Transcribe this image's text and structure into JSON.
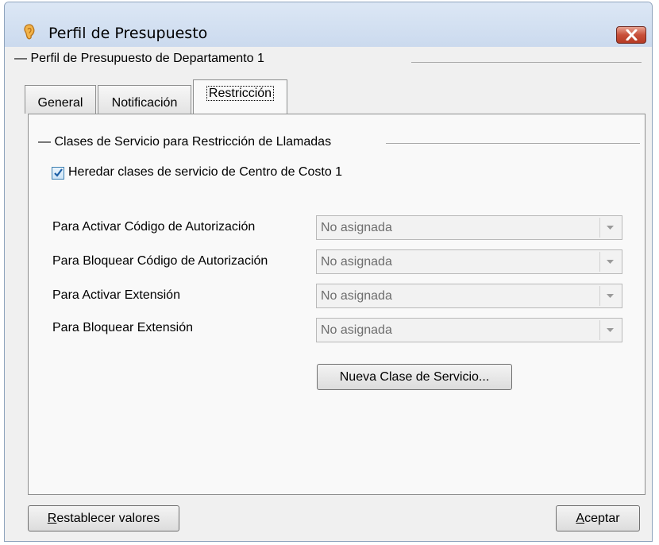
{
  "window": {
    "title": "Perfil de Presupuesto",
    "app_icon": "ear-icon",
    "close_icon": "close-icon"
  },
  "group_profile": {
    "label": "Perfil de Presupuesto de Departamento 1"
  },
  "tabs": [
    {
      "label": "General",
      "active": false
    },
    {
      "label": "Notificación",
      "active": false
    },
    {
      "label": "Restricción",
      "active": true
    }
  ],
  "restriction": {
    "group_label": "Clases de Servicio para Restricción de Llamadas",
    "inherit_checkbox": {
      "label": "Heredar clases de servicio de Centro de Costo 1",
      "checked": true
    },
    "rows": [
      {
        "label": "Para Activar Código de Autorización",
        "value": "No asignada"
      },
      {
        "label": "Para Bloquear Código de Autorización",
        "value": "No asignada"
      },
      {
        "label": "Para Activar Extensión",
        "value": "No asignada"
      },
      {
        "label": "Para Bloquear Extensión",
        "value": "No asignada"
      }
    ],
    "new_class_button": "Nueva Clase de Servicio..."
  },
  "footer": {
    "reset_button": {
      "mnemonic": "R",
      "rest": "establecer valores"
    },
    "accept_button": {
      "mnemonic": "A",
      "rest": "ceptar"
    }
  },
  "colors": {
    "close_button": "#c8503a",
    "titlebar": "#cbdaee",
    "checkbox_check": "#1d5fa5"
  }
}
